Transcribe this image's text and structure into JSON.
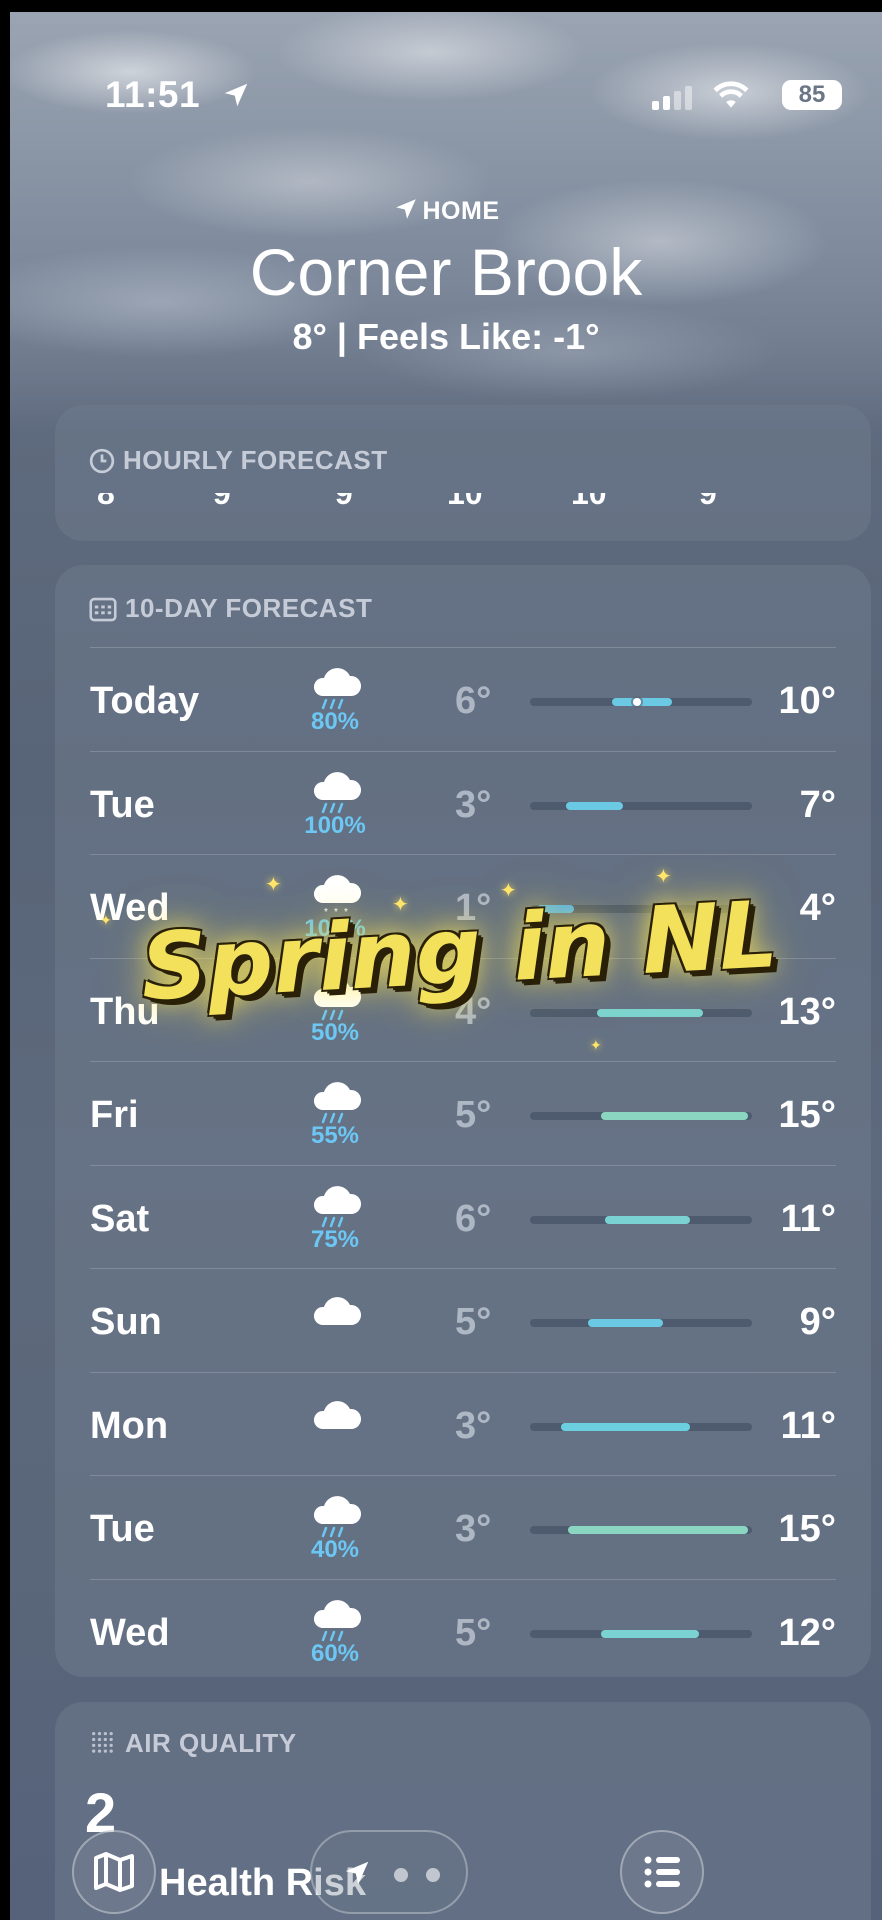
{
  "status_bar": {
    "time": "11:51",
    "battery": "85"
  },
  "header": {
    "location_label": "HOME",
    "city": "Corner Brook",
    "temps": "8°  |  Feels Like: -1°"
  },
  "hourly": {
    "title": "HOURLY FORECAST",
    "hours": [
      "8",
      "9",
      "9",
      "10",
      "10",
      "9"
    ]
  },
  "ten_day": {
    "title": "10-DAY FORECAST",
    "days": [
      {
        "name": "Today",
        "icon": "rain-cloud-icon",
        "pct": "80%",
        "lo": "6°",
        "hi": "10°",
        "range": [
          0.37,
          0.64
        ],
        "current": 0.48,
        "color": "#6cc9e4"
      },
      {
        "name": "Tue",
        "icon": "rain-cloud-icon",
        "pct": "100%",
        "lo": "3°",
        "hi": "7°",
        "range": [
          0.16,
          0.42
        ],
        "color": "#6cc9e4"
      },
      {
        "name": "Wed",
        "icon": "snow-cloud-icon",
        "pct": "100%",
        "lo": "1°",
        "hi": "4°",
        "range": [
          0.03,
          0.2
        ],
        "color": "#5ab4e8"
      },
      {
        "name": "Thu",
        "icon": "rain-cloud-icon",
        "pct": "50%",
        "lo": "4°",
        "hi": "13°",
        "range": [
          0.3,
          0.78
        ],
        "color": "#7cd3cf"
      },
      {
        "name": "Fri",
        "icon": "rain-cloud-icon",
        "pct": "55%",
        "lo": "5°",
        "hi": "15°",
        "range": [
          0.32,
          0.98
        ],
        "color": "#8ad6c0"
      },
      {
        "name": "Sat",
        "icon": "rain-cloud-icon",
        "pct": "75%",
        "lo": "6°",
        "hi": "11°",
        "range": [
          0.34,
          0.72
        ],
        "color": "#7ad3d2"
      },
      {
        "name": "Sun",
        "icon": "cloud-icon",
        "pct": "",
        "lo": "5°",
        "hi": "9°",
        "range": [
          0.26,
          0.6
        ],
        "color": "#6cc9e4"
      },
      {
        "name": "Mon",
        "icon": "cloud-icon",
        "pct": "",
        "lo": "3°",
        "hi": "11°",
        "range": [
          0.14,
          0.72
        ],
        "color": "#6ccfe0"
      },
      {
        "name": "Tue",
        "icon": "rain-cloud-icon",
        "pct": "40%",
        "lo": "3°",
        "hi": "15°",
        "range": [
          0.17,
          0.98
        ],
        "color": "#8ad6c0"
      },
      {
        "name": "Wed",
        "icon": "rain-cloud-icon",
        "pct": "60%",
        "lo": "5°",
        "hi": "12°",
        "range": [
          0.32,
          0.76
        ],
        "color": "#7ad3d2"
      }
    ]
  },
  "air_quality": {
    "title": "AIR QUALITY",
    "value": "2",
    "risk": "Health Risk"
  },
  "overlay": {
    "text": "Spring in NL"
  }
}
